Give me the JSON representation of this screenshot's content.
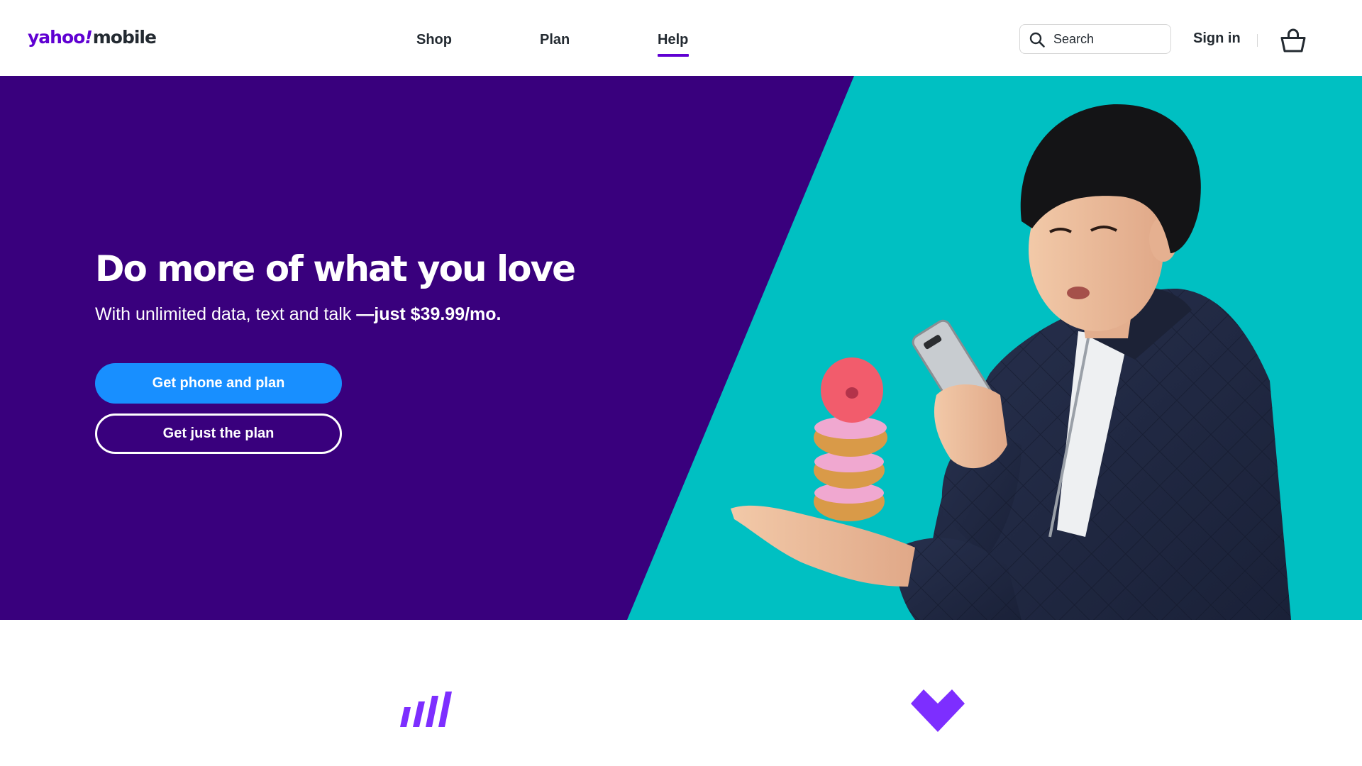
{
  "header": {
    "logo": {
      "part1": "yahoo",
      "part2": "!",
      "part3": "mobile"
    },
    "nav": [
      {
        "label": "Shop",
        "active": false
      },
      {
        "label": "Plan",
        "active": false
      },
      {
        "label": "Help",
        "active": true
      }
    ],
    "search": {
      "placeholder": "Search",
      "value": "",
      "icon": "search-icon"
    },
    "sign_in_label": "Sign in",
    "cart_icon": "shopping-basket-icon"
  },
  "hero": {
    "title": "Do more of what you love",
    "subtitle_plain": "With unlimited data, text and talk ",
    "subtitle_bold": "—just $39.99/mo.",
    "primary_button_label": "Get phone and plan",
    "secondary_button_label": "Get just the plan",
    "image_description": "Man in navy quilted jacket holding a smartphone and a stack of pink frosted donuts on his palm against a teal background"
  },
  "features": {
    "icons": [
      "signal-bars-icon",
      "heart-icon"
    ]
  },
  "colors": {
    "brand_purple": "#6001d2",
    "hero_purple": "#39007d",
    "hero_teal": "#00c0c2",
    "primary_button": "#188fff",
    "feature_icon": "#7d2eff",
    "text_dark": "#232a31"
  }
}
